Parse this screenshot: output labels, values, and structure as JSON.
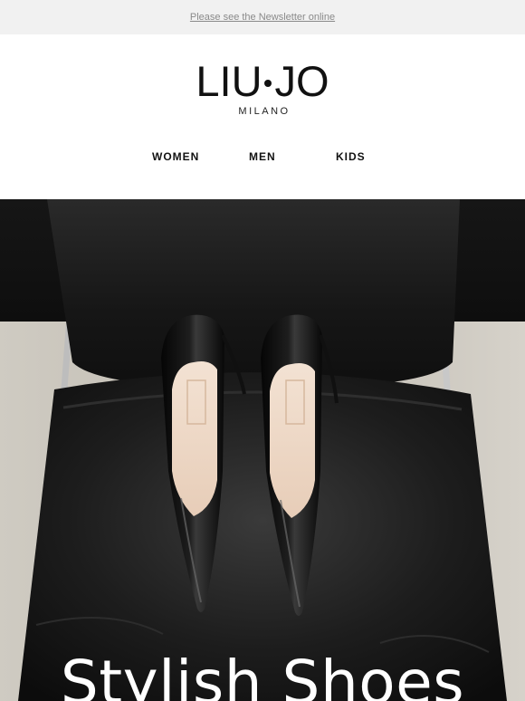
{
  "preheader": {
    "link_text": "Please see the Newsletter online"
  },
  "brand": {
    "logo_left": "LIU",
    "logo_right": "JO",
    "sub": "MILANO"
  },
  "nav": {
    "items": [
      "WOMEN",
      "MEN",
      "KIDS"
    ]
  },
  "hero": {
    "title": "Stylish Shoes",
    "image_subject": "black patent pointed pumps on black leather chair"
  },
  "colors": {
    "topbar_bg": "#f1f1f1",
    "link": "#8a8a8a",
    "text": "#111111",
    "hero_text": "#ffffff"
  }
}
